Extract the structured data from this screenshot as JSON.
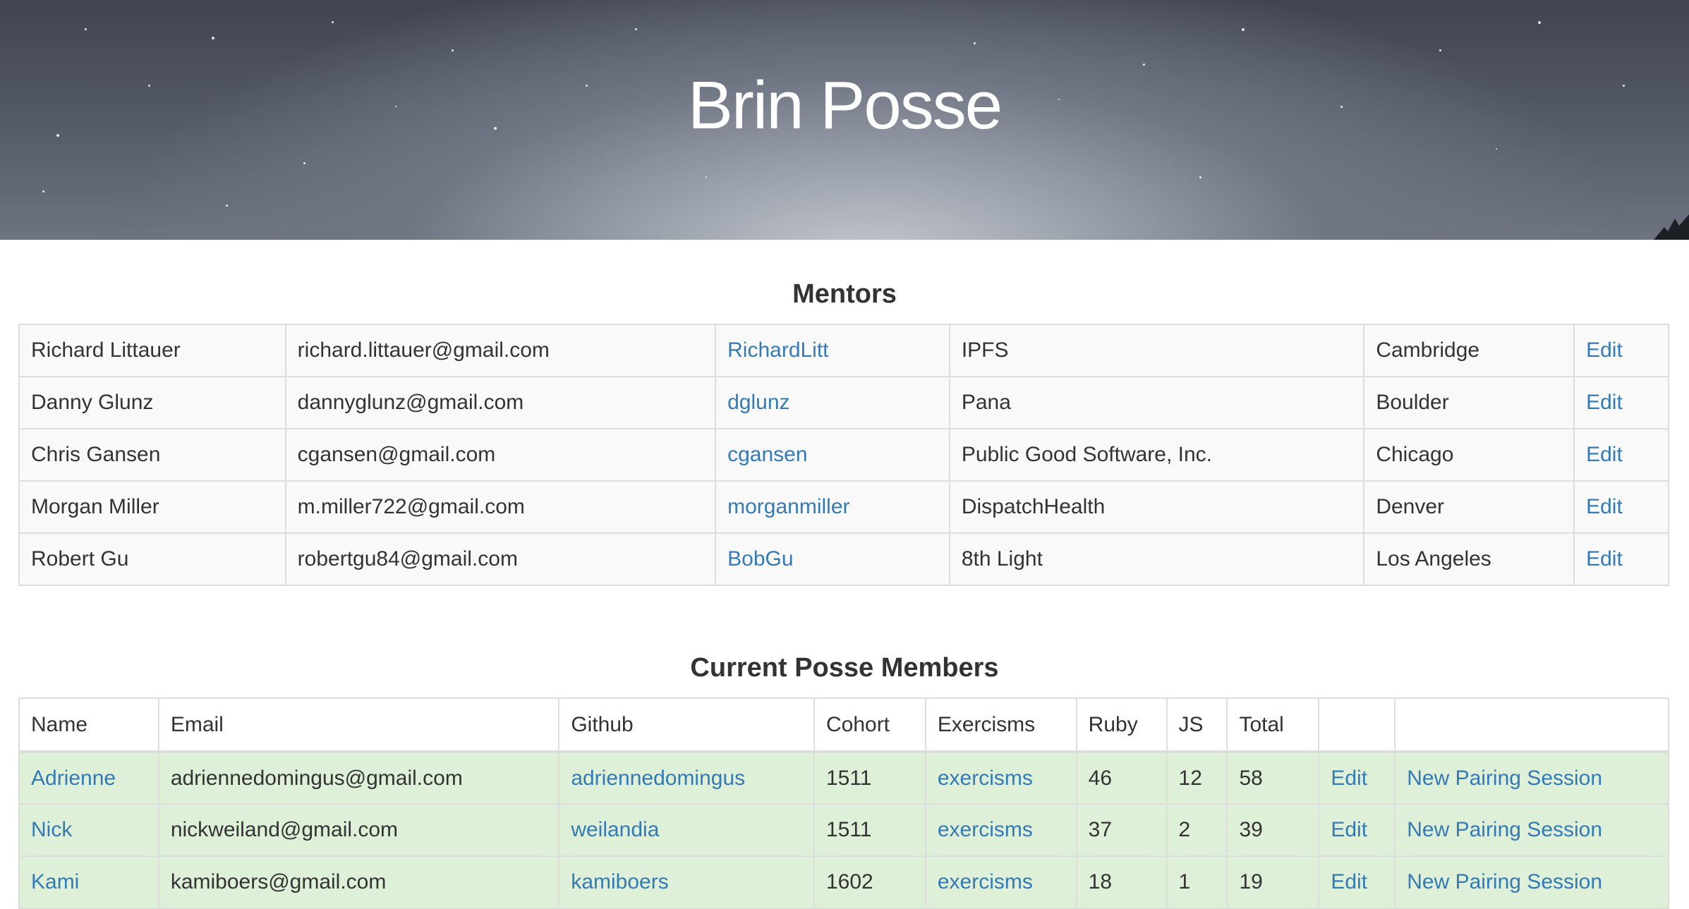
{
  "header": {
    "title": "Brin Posse"
  },
  "mentors": {
    "title": "Mentors",
    "rows": [
      {
        "name": "Richard Littauer",
        "email": "richard.littauer@gmail.com",
        "github": "RichardLitt",
        "company": "IPFS",
        "city": "Cambridge",
        "edit": "Edit"
      },
      {
        "name": "Danny Glunz",
        "email": "dannyglunz@gmail.com",
        "github": "dglunz",
        "company": "Pana",
        "city": "Boulder",
        "edit": "Edit"
      },
      {
        "name": "Chris Gansen",
        "email": "cgansen@gmail.com",
        "github": "cgansen",
        "company": "Public Good Software, Inc.",
        "city": "Chicago",
        "edit": "Edit"
      },
      {
        "name": "Morgan Miller",
        "email": "m.miller722@gmail.com",
        "github": "morganmiller",
        "company": "DispatchHealth",
        "city": "Denver",
        "edit": "Edit"
      },
      {
        "name": "Robert Gu",
        "email": "robertgu84@gmail.com",
        "github": "BobGu",
        "company": "8th Light",
        "city": "Los Angeles",
        "edit": "Edit"
      }
    ]
  },
  "members": {
    "title": "Current Posse Members",
    "columns": [
      "Name",
      "Email",
      "Github",
      "Cohort",
      "Exercisms",
      "Ruby",
      "JS",
      "Total",
      "",
      ""
    ],
    "rows": [
      {
        "name": "Adrienne",
        "email": "adriennedomingus@gmail.com",
        "github": "adriennedomingus",
        "cohort": "1511",
        "exercisms": "exercisms",
        "ruby": "46",
        "js": "12",
        "total": "58",
        "edit": "Edit",
        "pairing": "New Pairing Session"
      },
      {
        "name": "Nick",
        "email": "nickweiland@gmail.com",
        "github": "weilandia",
        "cohort": "1511",
        "exercisms": "exercisms",
        "ruby": "37",
        "js": "2",
        "total": "39",
        "edit": "Edit",
        "pairing": "New Pairing Session"
      },
      {
        "name": "Kami",
        "email": "kamiboers@gmail.com",
        "github": "kamiboers",
        "cohort": "1602",
        "exercisms": "exercisms",
        "ruby": "18",
        "js": "1",
        "total": "19",
        "edit": "Edit",
        "pairing": "New Pairing Session"
      }
    ]
  },
  "colors": {
    "link": "#337ab7",
    "success_row": "#dff0d8",
    "striped_row": "#f9f9f9",
    "border": "#dddddd"
  }
}
